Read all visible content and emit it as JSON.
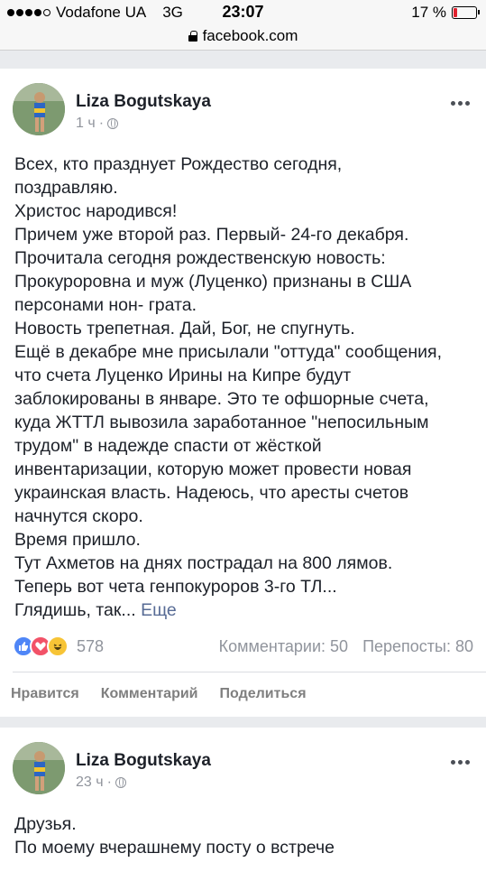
{
  "status_bar": {
    "carrier": "Vodafone UA",
    "network": "3G",
    "time": "23:07",
    "battery_percent": "17 %",
    "battery_level": 0.17,
    "signal_bars": 4
  },
  "url_bar": {
    "domain": "facebook.com"
  },
  "posts": [
    {
      "author": "Liza Bogutskaya",
      "time": "1 ч",
      "lines": [
        "Всех, кто празднует Рождество сегодня,",
        "поздравляю.",
        "Христос народився!",
        "Причем уже второй раз. Первый- 24-го декабря.",
        "Прочитала сегодня рождественскую новость:",
        "Прокуроровна и муж (Луценко) признаны в США",
        "персонами нон- грата.",
        "Новость трепетная. Дай, Бог, не спугнуть.",
        "Ещё в декабре мне присылали \"оттуда\" сообщения,",
        "что счета Луценко Ирины на Кипре будут",
        "заблокированы в январе. Это те офшорные счета,",
        "куда ЖТТЛ вывозила заработанное \"непосильным",
        "трудом\" в надежде спасти от жёсткой",
        "инвентаризации, которую может провести новая",
        "украинская власть. Надеюсь, что аресты счетов",
        "начнутся скоро.",
        "Время пришло.",
        "Тут Ахметов на днях пострадал на 800 лямов.",
        "Теперь вот чета генпокуроров 3-го ТЛ..."
      ],
      "last_line": "Глядишь, так...",
      "see_more": "Еще",
      "reaction_count": "578",
      "comments": "Комментарии: 50",
      "shares": "Перепосты: 80",
      "actions": {
        "like": "Нравится",
        "comment": "Комментарий",
        "share": "Поделиться"
      }
    },
    {
      "author": "Liza Bogutskaya",
      "time": "23 ч",
      "lines": [
        "Друзья.",
        "По моему вчерашнему посту о встрече"
      ]
    }
  ]
}
